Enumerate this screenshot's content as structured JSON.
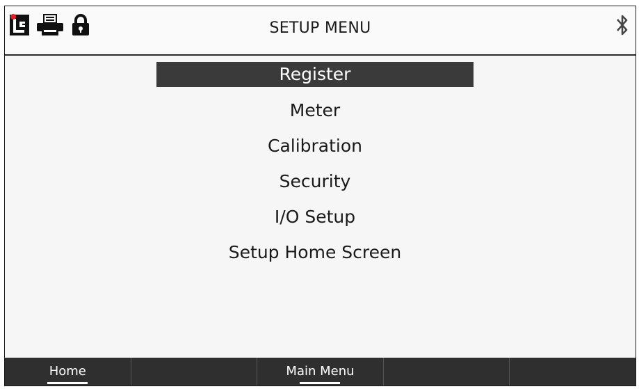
{
  "header": {
    "title": "SETUP MENU",
    "icons": [
      "lc-logo-icon",
      "printer-icon",
      "lock-icon",
      "bluetooth-icon"
    ]
  },
  "menu": {
    "items": [
      {
        "label": "Register",
        "selected": true
      },
      {
        "label": "Meter"
      },
      {
        "label": "Calibration"
      },
      {
        "label": "Security"
      },
      {
        "label": "I/O Setup"
      },
      {
        "label": "Setup Home Screen"
      }
    ]
  },
  "footer": {
    "softkeys": [
      {
        "label": "Home"
      },
      {
        "label": ""
      },
      {
        "label": "Main Menu"
      },
      {
        "label": ""
      },
      {
        "label": ""
      }
    ]
  },
  "colors": {
    "selection_bg": "#3a3a3a",
    "footer_bg": "#2f2f2f",
    "logo_dot": "#e0202a"
  }
}
